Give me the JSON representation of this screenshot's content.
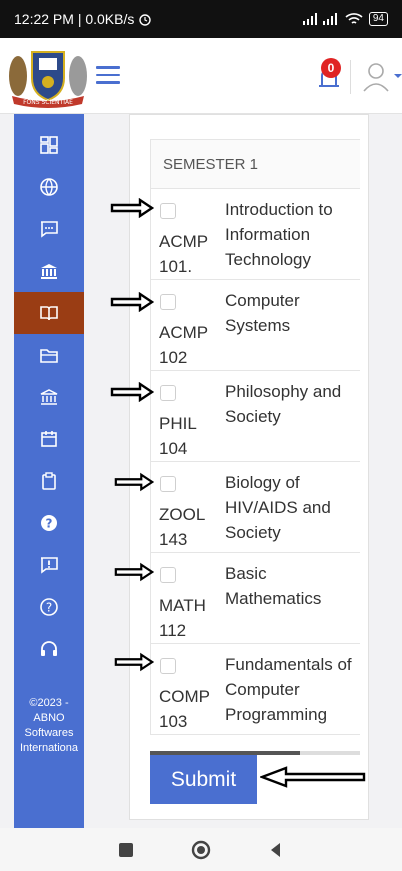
{
  "status_bar": {
    "time_speed": "12:22 PM | 0.0KB/s",
    "battery": "94"
  },
  "header": {
    "logo_text": "FONS SCIENTIAE",
    "notification_count": "0"
  },
  "sidebar": {
    "items": [
      {
        "icon": "dashboard-icon"
      },
      {
        "icon": "globe-icon"
      },
      {
        "icon": "chat-icon"
      },
      {
        "icon": "bank-icon"
      },
      {
        "icon": "book-open-icon"
      },
      {
        "icon": "folder-icon"
      },
      {
        "icon": "institution-icon"
      },
      {
        "icon": "calendar-icon"
      },
      {
        "icon": "clipboard-icon"
      },
      {
        "icon": "help-filled-icon"
      },
      {
        "icon": "report-icon"
      },
      {
        "icon": "help-outline-icon"
      },
      {
        "icon": "headset-icon"
      }
    ],
    "footer": [
      "©2023 -",
      "ABNO",
      "Softwares",
      "Internationa"
    ]
  },
  "table": {
    "semester": "SEMESTER 1",
    "courses": [
      {
        "code": "ACMP 101.",
        "title": "Introduction to Information Technology"
      },
      {
        "code": "ACMP 102",
        "title": "Computer Systems"
      },
      {
        "code": "PHIL 104",
        "title": "Philosophy and Society"
      },
      {
        "code": "ZOOL 143",
        "title": "Biology of HIV/AIDS and Society"
      },
      {
        "code": "MATH 112",
        "title": "Basic Mathematics"
      },
      {
        "code": "COMP 103",
        "title": "Fundamentals of Computer Programming"
      }
    ]
  },
  "submit_label": "Submit",
  "colors": {
    "primary": "#4a6fd0",
    "active": "#9a3d14",
    "badge": "#e02424"
  }
}
